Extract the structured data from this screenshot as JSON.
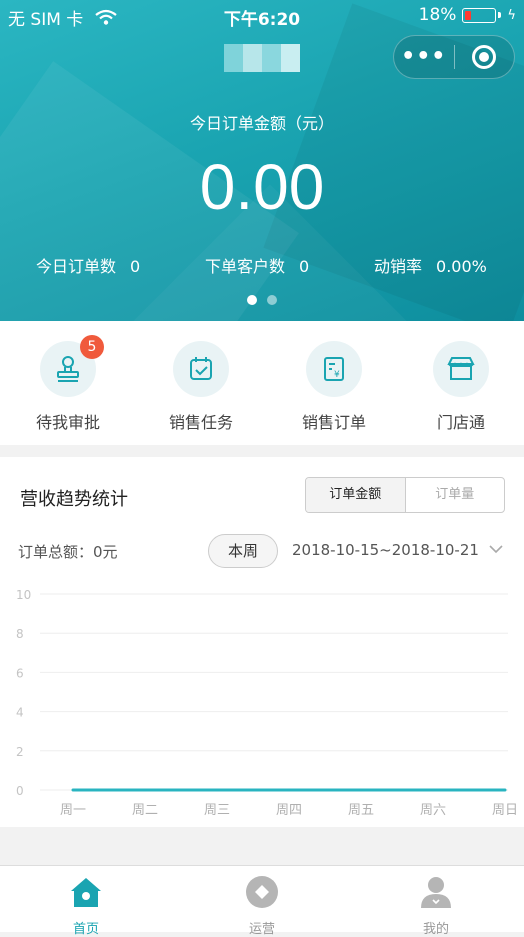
{
  "status_bar": {
    "carrier": "无 SIM 卡",
    "time": "下午6:20",
    "battery": "18%"
  },
  "header": {
    "title_blurred": "",
    "today_amount_label": "今日订单金额（元）",
    "today_amount": "0.00",
    "stats": [
      {
        "label": "今日订单数",
        "value": "0"
      },
      {
        "label": "下单客户数",
        "value": "0"
      },
      {
        "label": "动销率",
        "value": "0.00%"
      }
    ],
    "carousel_page": 1,
    "carousel_total": 2
  },
  "quick_menu": [
    {
      "label": "待我审批",
      "icon": "stamp-icon",
      "badge": "5"
    },
    {
      "label": "销售任务",
      "icon": "calendar-check-icon"
    },
    {
      "label": "销售订单",
      "icon": "receipt-yen-icon"
    },
    {
      "label": "门店通",
      "icon": "storefront-icon"
    }
  ],
  "trend": {
    "title": "营收趋势统计",
    "toggle": {
      "options": [
        "订单金额",
        "订单量"
      ],
      "selected": "订单金额"
    },
    "total_label": "订单总额：0元",
    "period_button": "本周",
    "date_range": "2018-10-15~2018-10-21"
  },
  "chart_data": {
    "type": "line",
    "categories": [
      "周一",
      "周二",
      "周三",
      "周四",
      "周五",
      "周六",
      "周日"
    ],
    "series": [
      {
        "values": [
          0,
          0,
          0,
          0,
          0,
          0,
          0
        ]
      }
    ],
    "y_ticks": [
      0,
      2,
      4,
      6,
      8,
      10
    ],
    "ylim": [
      0,
      10
    ],
    "grid": true,
    "line_color": "#29b4c0"
  },
  "tab_bar": [
    {
      "label": "首页",
      "icon": "home-icon",
      "active": true
    },
    {
      "label": "运营",
      "icon": "operations-icon",
      "active": false
    },
    {
      "label": "我的",
      "icon": "profile-icon",
      "active": false
    }
  ],
  "colors": {
    "accent": "#1aa4b1",
    "badge": "#f05a3c",
    "inactive": "#b5b5b5"
  }
}
